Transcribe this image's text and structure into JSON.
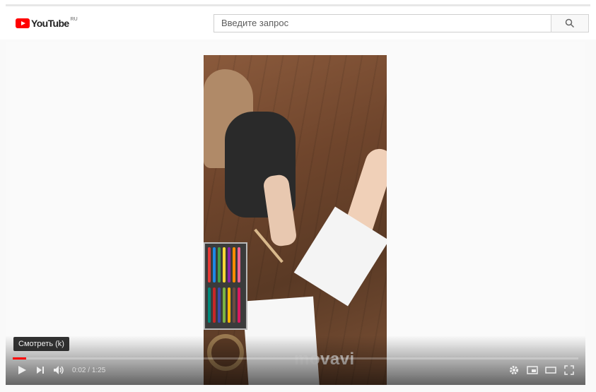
{
  "header": {
    "logo_text": "YouTube",
    "region": "RU",
    "search_placeholder": "Введите запрос",
    "brand_color": "#ff0000"
  },
  "player": {
    "tooltip": "Смотреть (k)",
    "time_current": "0:02",
    "time_separator": " / ",
    "time_total": "1:25",
    "progress_fraction": 0.024,
    "watermark": "movavi",
    "icons": [
      "play-icon",
      "next-icon",
      "volume-icon",
      "settings-icon",
      "miniplayer-icon",
      "theater-icon",
      "fullscreen-icon"
    ]
  }
}
